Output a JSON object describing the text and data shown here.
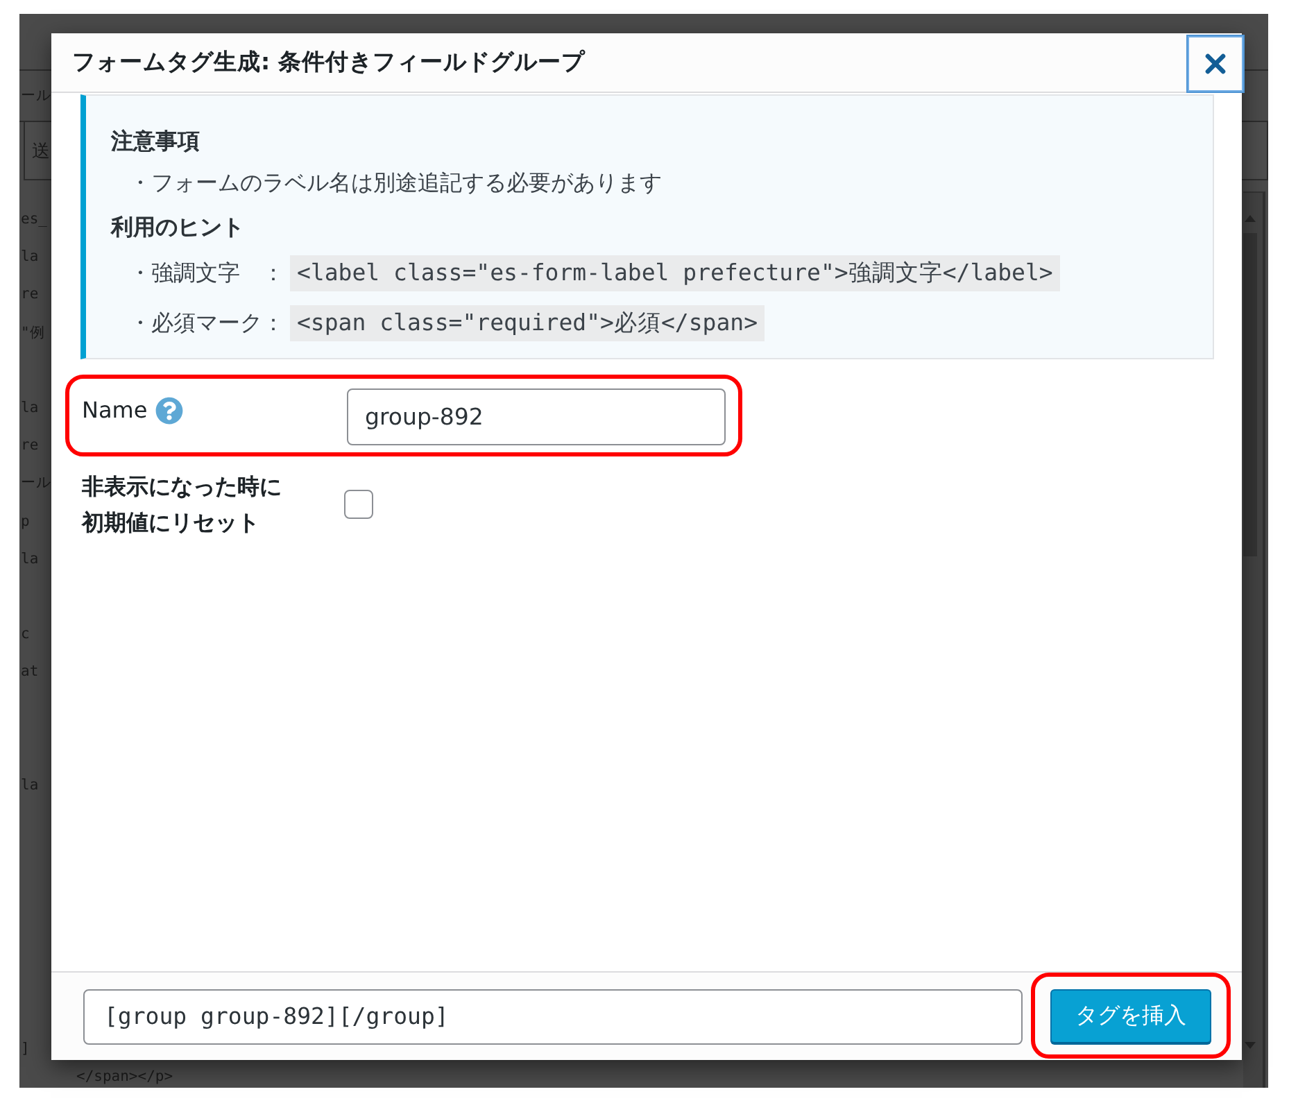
{
  "background": {
    "tab_label": "ール",
    "toolbar_button": "送",
    "code_line_groups": [
      [
        "es_",
        "la",
        "re",
        "\"例"
      ],
      [
        "la",
        "re",
        "ール",
        "p",
        "la"
      ],
      [
        "c",
        "at"
      ],
      [
        "la"
      ],
      [
        "]"
      ]
    ],
    "trailing_line": "</span></p>"
  },
  "dialog": {
    "title": "フォームタグ生成: 条件付きフィールドグループ",
    "notice": {
      "heading": "注意事項",
      "items": [
        "・フォームのラベル名は別途追記する必要があります"
      ]
    },
    "hints": {
      "heading": "利用のヒント",
      "items": [
        {
          "label": "・強調文字　：",
          "code": "<label class=\"es-form-label prefecture\">強調文字</label>"
        },
        {
          "label": "・必須マーク：",
          "code": "<span class=\"required\">必須</span>"
        }
      ]
    },
    "fields": [
      {
        "kind": "text",
        "label": "Name",
        "help": true,
        "value": "group-892",
        "highlighted": true
      },
      {
        "kind": "checkbox",
        "label": "非表示になった時に初期値にリセット",
        "checked": false
      }
    ],
    "footer": {
      "tag_code": "[group group-892][/group]",
      "insert_button": {
        "label": "タグを挿入",
        "highlighted": true
      }
    }
  }
}
